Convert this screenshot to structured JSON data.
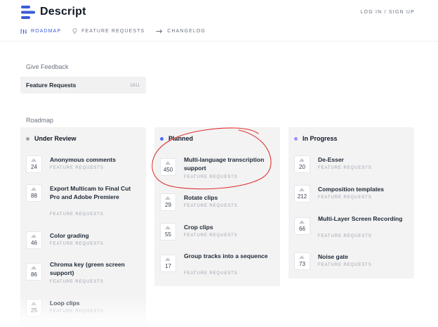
{
  "header": {
    "brand": "Descript",
    "login": "LOG IN / SIGN UP",
    "brand_color": "#3b5bdb"
  },
  "nav": [
    {
      "label": "ROADMAP",
      "icon": "roadmap-icon",
      "active": true
    },
    {
      "label": "FEATURE REQUESTS",
      "icon": "lightbulb-icon",
      "active": false
    },
    {
      "label": "CHANGELOG",
      "icon": "arrow-right-icon",
      "active": false
    }
  ],
  "feedback": {
    "heading": "Give Feedback",
    "board_title": "Feature Requests",
    "board_count": "1811"
  },
  "roadmap": {
    "heading": "Roadmap",
    "columns": [
      {
        "title": "Under Review",
        "dot_color": "#9ca3af",
        "cards": [
          {
            "votes": "24",
            "title": "Anonymous comments",
            "tag": "FEATURE REQUESTS"
          },
          {
            "votes": "88",
            "title": "Export Multicam to Final Cut Pro and Adobe Premiere",
            "tag": "FEATURE REQUESTS"
          },
          {
            "votes": "46",
            "title": "Color grading",
            "tag": "FEATURE REQUESTS"
          },
          {
            "votes": "86",
            "title": "Chroma key (green screen support)",
            "tag": "FEATURE REQUESTS"
          },
          {
            "votes": "25",
            "title": "Loop clips",
            "tag": "FEATURE REQUESTS"
          }
        ]
      },
      {
        "title": "Planned",
        "dot_color": "#4c6ef5",
        "cards": [
          {
            "votes": "450",
            "title": "Multi-language transcription support",
            "tag": "FEATURE REQUESTS"
          },
          {
            "votes": "29",
            "title": "Rotate clips",
            "tag": "FEATURE REQUESTS"
          },
          {
            "votes": "55",
            "title": "Crop clips",
            "tag": "FEATURE REQUESTS"
          },
          {
            "votes": "17",
            "title": "Group tracks into a sequence",
            "tag": "FEATURE REQUESTS"
          }
        ]
      },
      {
        "title": "In Progress",
        "dot_color": "#a78bfa",
        "cards": [
          {
            "votes": "20",
            "title": "De-Esser",
            "tag": "FEATURE REQUESTS"
          },
          {
            "votes": "212",
            "title": "Composition templates",
            "tag": "FEATURE REQUESTS"
          },
          {
            "votes": "66",
            "title": "Multi-Layer Screen Recording",
            "tag": "FEATURE REQUESTS"
          },
          {
            "votes": "73",
            "title": "Noise gate",
            "tag": "FEATURE REQUESTS"
          }
        ]
      }
    ]
  },
  "annotation_color": "#e03131"
}
